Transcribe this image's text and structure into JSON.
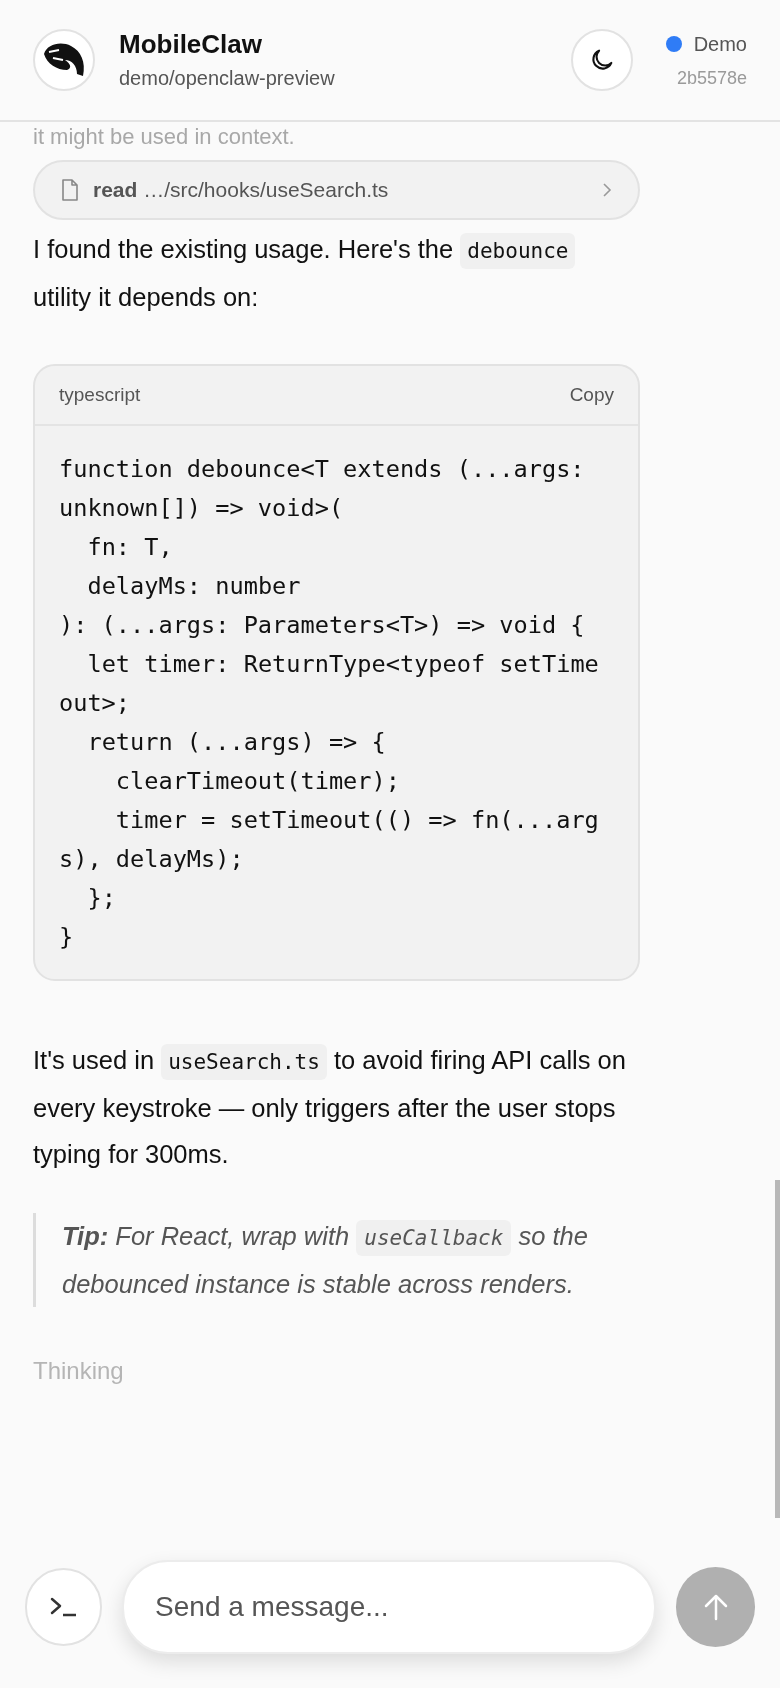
{
  "header": {
    "title": "MobileClaw",
    "subtitle": "demo/openclaw-preview",
    "connection": {
      "label": "Demo",
      "color": "#2f7cf6",
      "commit": "2b5578e"
    }
  },
  "messages": [
    {
      "kind": "faded",
      "text": "it might be used in context."
    },
    {
      "kind": "tool",
      "tool": "read",
      "target": "…/src/hooks/useSearch.ts"
    },
    {
      "kind": "paragraph",
      "segments": [
        {
          "kind": "text",
          "text": "I found the existing usage. Here's the "
        },
        {
          "kind": "code",
          "text": "debounce"
        },
        {
          "kind": "text",
          "text": " utility it depends on:"
        }
      ]
    },
    {
      "kind": "codeblock",
      "language": "typescript",
      "copy": "Copy",
      "code": "function debounce<T extends (...args: unknown[]) => void>(\n  fn: T,\n  delayMs: number\n): (...args: Parameters<T>) => void {\n  let timer: ReturnType<typeof setTimeout>;\n  return (...args) => {\n    clearTimeout(timer);\n    timer = setTimeout(() => fn(...args), delayMs);\n  };\n}"
    },
    {
      "kind": "paragraph",
      "segments": [
        {
          "kind": "text",
          "text": "It's used in "
        },
        {
          "kind": "code",
          "text": "useSearch.ts"
        },
        {
          "kind": "text",
          "text": " to avoid firing API calls on every keystroke — only triggers after the user stops typing for 300ms."
        }
      ]
    },
    {
      "kind": "quote",
      "segments": [
        {
          "kind": "text",
          "text": "**Tip:** For React, wrap with "
        },
        {
          "kind": "code",
          "text": "useCallback"
        },
        {
          "kind": "text",
          "text": " so the debounced instance is stable across renders."
        }
      ]
    },
    {
      "kind": "thinking",
      "text": "Thinking"
    }
  ],
  "composer": {
    "placeholder": "Send a message..."
  }
}
